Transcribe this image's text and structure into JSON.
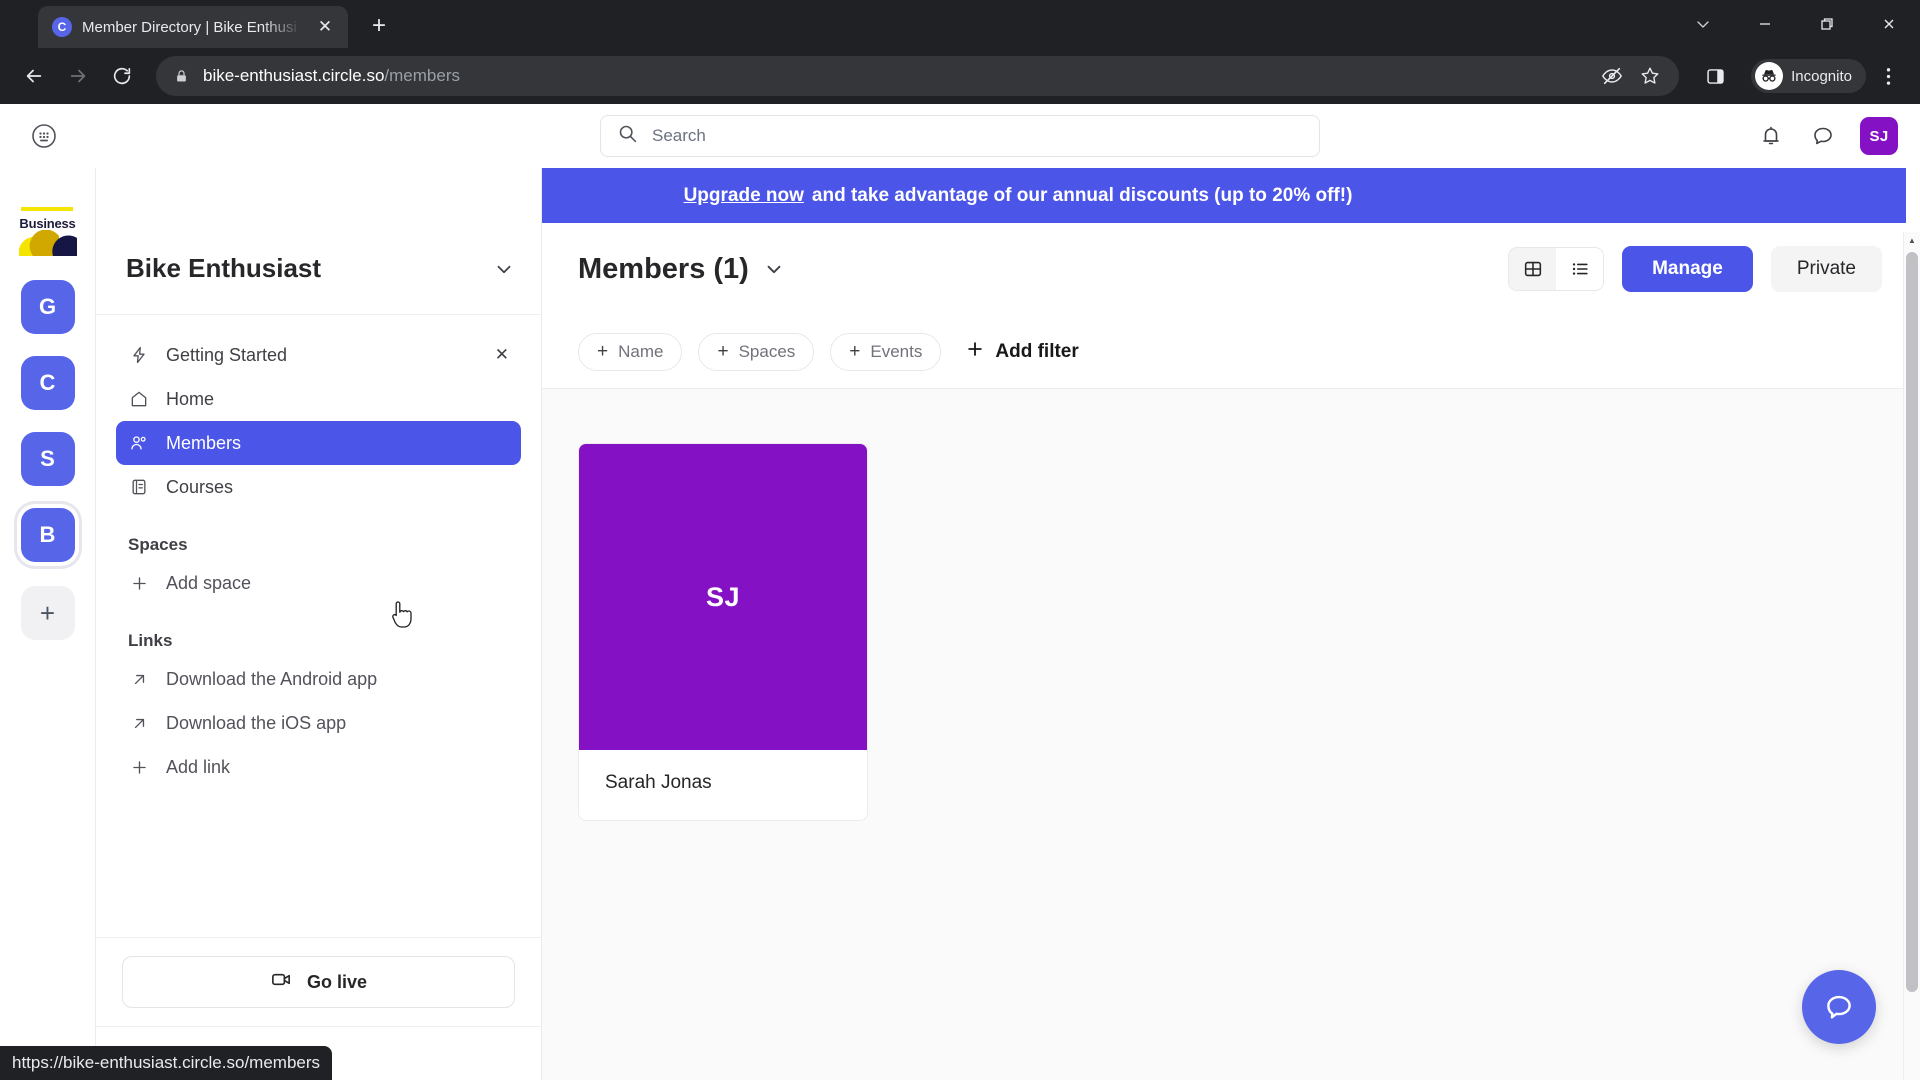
{
  "browser": {
    "tab": {
      "title": "Member Directory | Bike Enthusi",
      "favicon_letter": "C",
      "favicon_name": "circle-favicon",
      "close_label": "✕"
    },
    "new_tab_label": "+",
    "window_controls": [
      {
        "name": "minimize-to-tray-button",
        "glyph": "⌄"
      },
      {
        "name": "minimize-button",
        "glyph": "—"
      },
      {
        "name": "maximize-button",
        "glyph": "❐"
      },
      {
        "name": "close-window-button",
        "glyph": "✕"
      }
    ],
    "nav": {
      "back": "←",
      "forward": "→",
      "reload": "⟳"
    },
    "omnibox": {
      "domain": "bike-enthusiast.circle.so",
      "path": "/members",
      "lock_icon": "site-information-lock-icon"
    },
    "toolbar_icons": [
      {
        "name": "tracking-protection-icon"
      },
      {
        "name": "bookmark-star-icon"
      },
      {
        "name": "side-panel-icon"
      }
    ],
    "profile": {
      "label": "Incognito",
      "icon": "incognito-hat-glasses-icon"
    },
    "menu_icon": "chrome-menu-kebab-icon",
    "status_url": "https://bike-enthusiast.circle.so/members"
  },
  "app_header": {
    "apps_icon": "apps-grid-circle-icon",
    "search": {
      "placeholder": "Search",
      "value": "",
      "icon": "search-icon"
    },
    "notifications_icon": "bell-notification-icon",
    "messages_icon": "chat-bubble-icon",
    "avatar_initials": "SJ"
  },
  "banner": {
    "link_text": "Upgrade now",
    "rest_text": "and take advantage of our annual discounts (up to 20% off!)",
    "background": "#4b55e8"
  },
  "rail": {
    "logo_word": "Business",
    "communities": [
      {
        "letter": "G",
        "name": "community-g",
        "active": false
      },
      {
        "letter": "C",
        "name": "community-c",
        "active": false
      },
      {
        "letter": "S",
        "name": "community-s",
        "active": false
      },
      {
        "letter": "B",
        "name": "community-b",
        "active": true
      }
    ],
    "add_label": "+"
  },
  "sidebar": {
    "community_name": "Bike Enthusiast",
    "caret_icon": "chevron-down-icon",
    "nav": [
      {
        "label": "Getting Started",
        "icon": "lightning-bolt-icon",
        "active": false,
        "dismiss": "✕"
      },
      {
        "label": "Home",
        "icon": "home-icon",
        "active": false
      },
      {
        "label": "Members",
        "icon": "members-people-icon",
        "active": true
      },
      {
        "label": "Courses",
        "icon": "courses-list-icon",
        "active": false
      }
    ],
    "spaces": {
      "title": "Spaces",
      "add_label": "Add space",
      "add_icon": "plus-icon"
    },
    "links": {
      "title": "Links",
      "items": [
        {
          "label": "Download the Android app",
          "icon": "external-link-arrow-icon"
        },
        {
          "label": "Download the iOS app",
          "icon": "external-link-arrow-icon"
        },
        {
          "label": "Add link",
          "icon": "plus-icon"
        }
      ]
    },
    "go_live": {
      "label": "Go live",
      "icon": "video-camera-icon"
    }
  },
  "main": {
    "title": "Members (1)",
    "title_caret_icon": "chevron-down-icon",
    "view_toggle": [
      {
        "name": "grid-view-button",
        "icon": "grid-view-icon",
        "selected": true
      },
      {
        "name": "list-view-button",
        "icon": "list-view-icon",
        "selected": false
      }
    ],
    "manage_label": "Manage",
    "private_label": "Private",
    "filters": [
      {
        "label": "Name",
        "icon": "plus-icon"
      },
      {
        "label": "Spaces",
        "icon": "plus-icon"
      },
      {
        "label": "Events",
        "icon": "plus-icon"
      }
    ],
    "add_filter_label": "Add filter",
    "members": [
      {
        "name": "Sarah Jonas",
        "initials": "SJ",
        "avatar_color": "#8411c4"
      }
    ],
    "chat_icon": "messenger-chat-bubble-icon"
  },
  "colors": {
    "accent": "#4b55e8",
    "rail_tile": "#5766e8",
    "avatar_purple": "#8411c4",
    "chrome_dark": "#202124"
  }
}
